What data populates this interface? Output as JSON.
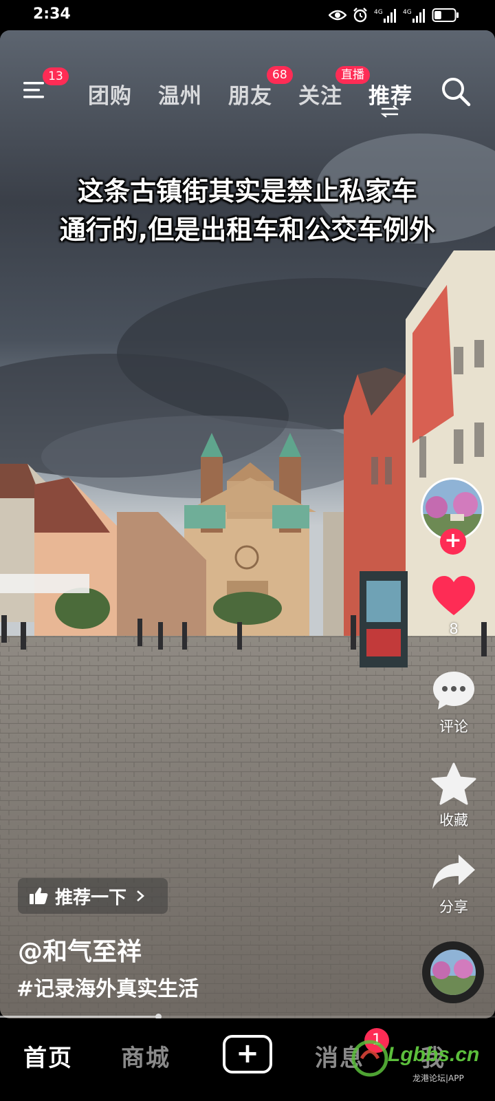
{
  "status_bar": {
    "time": "2:34",
    "battery_level": 0.35
  },
  "top_nav": {
    "menu_badge": "13",
    "tabs": [
      {
        "label": "团购"
      },
      {
        "label": "温州"
      },
      {
        "label": "朋友",
        "badge": "68"
      },
      {
        "label": "关注",
        "badge": "直播"
      },
      {
        "label": "推荐",
        "active": true
      }
    ]
  },
  "caption": {
    "line1": "这条古镇街其实是禁止私家车",
    "line2": "通行的,但是出租车和公交车例外"
  },
  "actions": {
    "like_count": "8",
    "comment_label": "评论",
    "favorite_label": "收藏",
    "share_label": "分享",
    "like_color": "#fe2c55"
  },
  "video_info": {
    "recommend_label": "推荐一下",
    "author": "@和气至祥",
    "hashtag": "#记录海外真实生活",
    "progress": 0.32
  },
  "bottom_nav": {
    "home": "首页",
    "mall": "商城",
    "messages": "消息",
    "message_badge": "1",
    "me": "我"
  },
  "watermark": {
    "logo": "Lgbbs.cn",
    "sub": "龙港论坛|APP"
  },
  "colors": {
    "accent": "#fe2c55",
    "background": "#000000"
  }
}
